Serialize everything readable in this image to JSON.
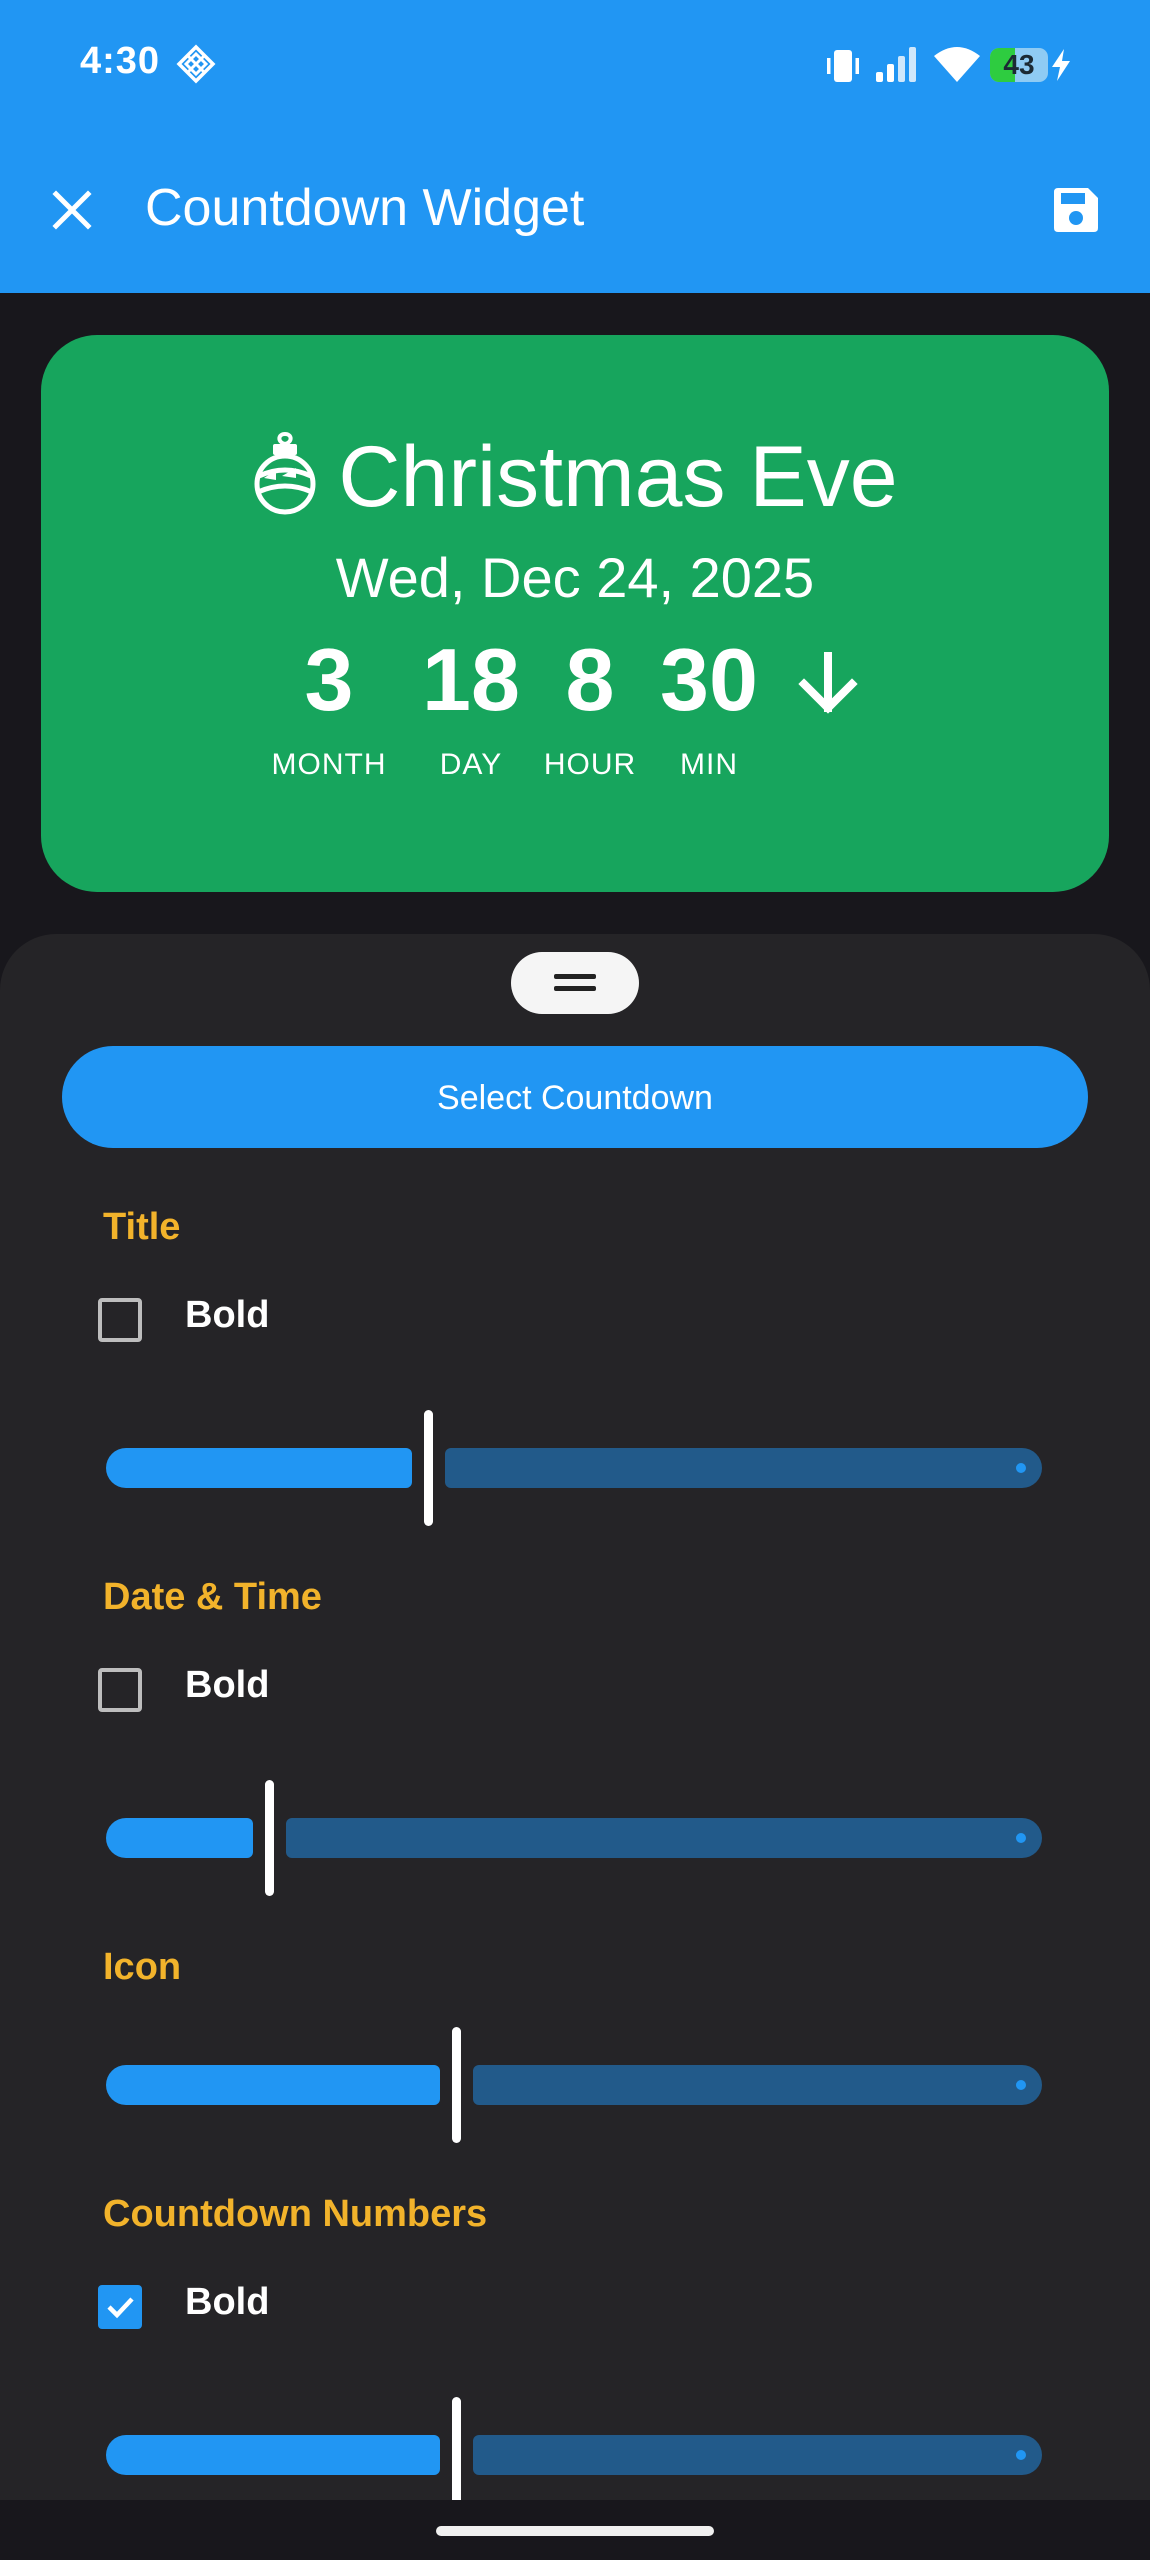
{
  "status_bar": {
    "time": "4:30",
    "battery_level": "43",
    "battery_fraction": 0.43,
    "icons": [
      "diamond-grid-icon",
      "vibrate-icon",
      "signal-icon",
      "wifi-icon",
      "battery-icon",
      "charging-bolt-icon"
    ]
  },
  "app_bar": {
    "title": "Countdown Widget",
    "left_icon": "close-icon",
    "right_icon": "save-icon"
  },
  "preview": {
    "icon": "christmas-ornament-icon",
    "event_title": "Christmas Eve",
    "event_date": "Wed, Dec 24, 2025",
    "countdown": [
      {
        "value": "3",
        "label": "MONTH"
      },
      {
        "value": "18",
        "label": "DAY"
      },
      {
        "value": "8",
        "label": "HOUR"
      },
      {
        "value": "30",
        "label": "MIN"
      }
    ],
    "trailing_icon": "arrow-down-icon",
    "colors": {
      "background": "#17a55d",
      "text": "#ffffff"
    }
  },
  "sheet": {
    "select_button": "Select Countdown",
    "sections": [
      {
        "title": "Title",
        "bold_label": "Bold",
        "bold_checked": false,
        "slider_value": 0.34
      },
      {
        "title": "Date & Time",
        "bold_label": "Bold",
        "bold_checked": false,
        "slider_value": 0.17
      },
      {
        "title": "Icon",
        "slider_value": 0.37
      },
      {
        "title": "Countdown Numbers",
        "bold_label": "Bold",
        "bold_checked": true,
        "slider_value": 0.37
      }
    ]
  },
  "colors": {
    "accent": "#2196f3",
    "section_title": "#f2b32b",
    "sheet_background": "#252427",
    "page_background": "#18171c"
  }
}
